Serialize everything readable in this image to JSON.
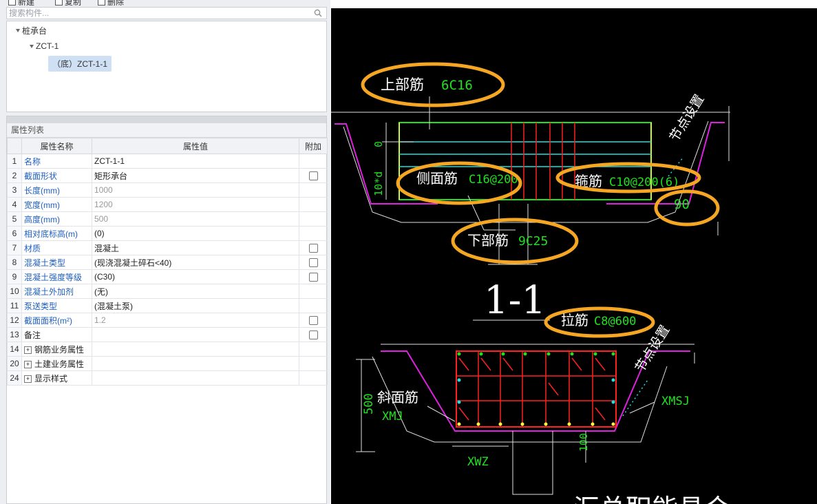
{
  "toolbar": {
    "items": [
      "新建",
      "复制",
      "删除"
    ]
  },
  "search": {
    "placeholder": "搜索构件..."
  },
  "tree": {
    "root": "桩承台",
    "child": "ZCT-1",
    "leaf": "（底）ZCT-1-1"
  },
  "props": {
    "title": "属性列表",
    "headers": [
      "属性名称",
      "属性值",
      "附加"
    ],
    "rows": [
      {
        "n": "1",
        "name": "名称",
        "value": "ZCT-1-1"
      },
      {
        "n": "2",
        "name": "截面形状",
        "value": "矩形承台"
      },
      {
        "n": "3",
        "name": "长度(mm)",
        "value": "1000"
      },
      {
        "n": "4",
        "name": "宽度(mm)",
        "value": "1200"
      },
      {
        "n": "5",
        "name": "高度(mm)",
        "value": "500"
      },
      {
        "n": "6",
        "name": "相对底标高(m)",
        "value": "(0)"
      },
      {
        "n": "7",
        "name": "材质",
        "value": "混凝土"
      },
      {
        "n": "8",
        "name": "混凝土类型",
        "value": "(现浇混凝土碎石<40)"
      },
      {
        "n": "9",
        "name": "混凝土强度等级",
        "value": "(C30)"
      },
      {
        "n": "10",
        "name": "混凝土外加剂",
        "value": "(无)"
      },
      {
        "n": "11",
        "name": "泵送类型",
        "value": "(混凝土泵)"
      },
      {
        "n": "12",
        "name": "截面面积(m²)",
        "value": "1.2"
      },
      {
        "n": "13",
        "name": "备注",
        "value": ""
      },
      {
        "n": "14",
        "name": "钢筋业务属性",
        "value": ""
      },
      {
        "n": "20",
        "name": "土建业务属性",
        "value": ""
      },
      {
        "n": "24",
        "name": "显示样式",
        "value": ""
      }
    ]
  },
  "drawing": {
    "top_label": "上部筋",
    "top_value": "6C16",
    "node_setting": "节点设置",
    "dim_zero": "0",
    "dim_10d": "10*d",
    "side_label": "侧面筋",
    "side_value": "C16@200",
    "stirrup_label": "箍筋",
    "stirrup_value": "C10@200(6)",
    "angle": "90",
    "bottom_label": "下部筋",
    "bottom_value": "9C25",
    "section_title": "1-1",
    "tie_label": "拉筋",
    "tie_value": "C8@600",
    "node_setting2": "节点设置",
    "dim_500": "500",
    "slope_label": "斜面筋",
    "slope_value": "XMJ",
    "xmsj": "XMSJ",
    "dim_100": "100",
    "xwz": "XWZ",
    "bottom_title": "汇总职能具合"
  },
  "colors": {
    "highlight": "#f5a623",
    "rebar_red": "#ff2020",
    "green": "#20e020",
    "cyan": "#20e0e0",
    "magenta": "#e020e0",
    "yellow": "#ffff40"
  }
}
